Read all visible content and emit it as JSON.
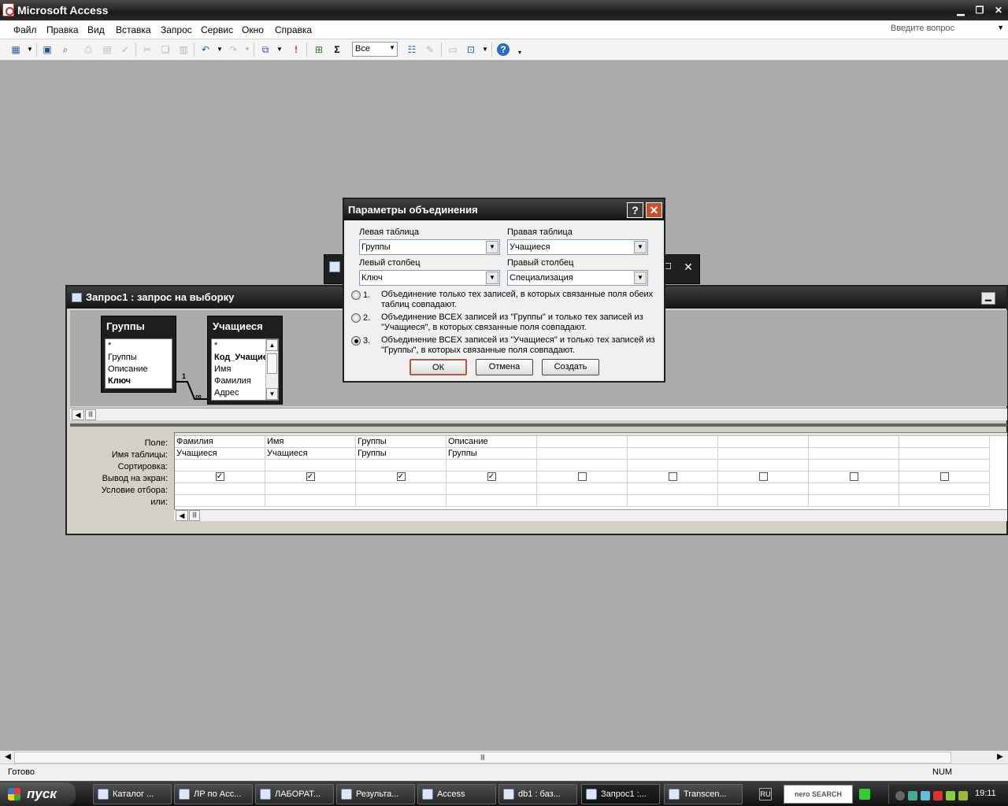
{
  "app": {
    "title": "Microsoft Access"
  },
  "menu": {
    "items": [
      "Файл",
      "Правка",
      "Вид",
      "Вставка",
      "Запрос",
      "Сервис",
      "Окно",
      "Справка"
    ],
    "ask_placeholder": "Введите вопрос"
  },
  "toolbar": {
    "scope_value": "Все"
  },
  "query_window": {
    "title": "Запрос1 : запрос на выборку",
    "tables": [
      {
        "name": "Группы",
        "fields": [
          "*",
          "Группы",
          "Описание",
          "Ключ"
        ]
      },
      {
        "name": "Учащиеся",
        "fields": [
          "*",
          "Код_Учащиеся",
          "Имя",
          "Фамилия",
          "Адрес"
        ]
      }
    ],
    "relation": {
      "one": "1",
      "many": "∞"
    },
    "grid": {
      "row_labels": [
        "Поле:",
        "Имя таблицы:",
        "Сортировка:",
        "Вывод на экран:",
        "Условие отбора:",
        "или:"
      ],
      "columns": [
        {
          "field": "Фамилия",
          "table": "Учащиеся",
          "show": true
        },
        {
          "field": "Имя",
          "table": "Учащиеся",
          "show": true
        },
        {
          "field": "Группы",
          "table": "Группы",
          "show": true
        },
        {
          "field": "Описание",
          "table": "Группы",
          "show": true
        },
        {
          "field": "",
          "table": "",
          "show": false
        },
        {
          "field": "",
          "table": "",
          "show": false
        },
        {
          "field": "",
          "table": "",
          "show": false
        },
        {
          "field": "",
          "table": "",
          "show": false
        },
        {
          "field": "",
          "table": "",
          "show": false
        }
      ]
    }
  },
  "dialog": {
    "title": "Параметры объединения",
    "help": "?",
    "left_table_label": "Левая таблица",
    "left_table_value": "Группы",
    "right_table_label": "Правая таблица",
    "right_table_value": "Учащиеся",
    "left_column_label": "Левый столбец",
    "left_column_value": "Ключ",
    "right_column_label": "Правый столбец",
    "right_column_value": "Специализация",
    "options": [
      {
        "num": "1.",
        "text": "Объединение только тех записей, в которых связанные поля обеих таблиц совпадают.",
        "selected": false
      },
      {
        "num": "2.",
        "text": "Объединение ВСЕХ записей из \"Группы\" и только тех записей из \"Учащиеся\", в которых связанные поля совпадают.",
        "selected": false
      },
      {
        "num": "3.",
        "text": "Объединение ВСЕХ записей из \"Учащиеся\" и только тех записей из \"Группы\", в которых связанные поля совпадают.",
        "selected": true
      }
    ],
    "ok": "ОК",
    "cancel": "Отмена",
    "create": "Создать"
  },
  "status": {
    "text": "Готово",
    "num": "NUM"
  },
  "taskbar": {
    "start": "пуск",
    "tasks": [
      "Каталог ...",
      "ЛР по Acc...",
      "ЛАБОРАТ...",
      "Результа...",
      "Access",
      "db1 : баз...",
      "Запрос1 :...",
      "Transcen..."
    ],
    "lang": "RU",
    "nero": "nero SEARCH",
    "clock": "19:11"
  },
  "colors": {
    "titlebar": "#1c1c1c",
    "workspace": "#ababab",
    "ok_border": "#b4593e",
    "close": "#c8502a"
  }
}
